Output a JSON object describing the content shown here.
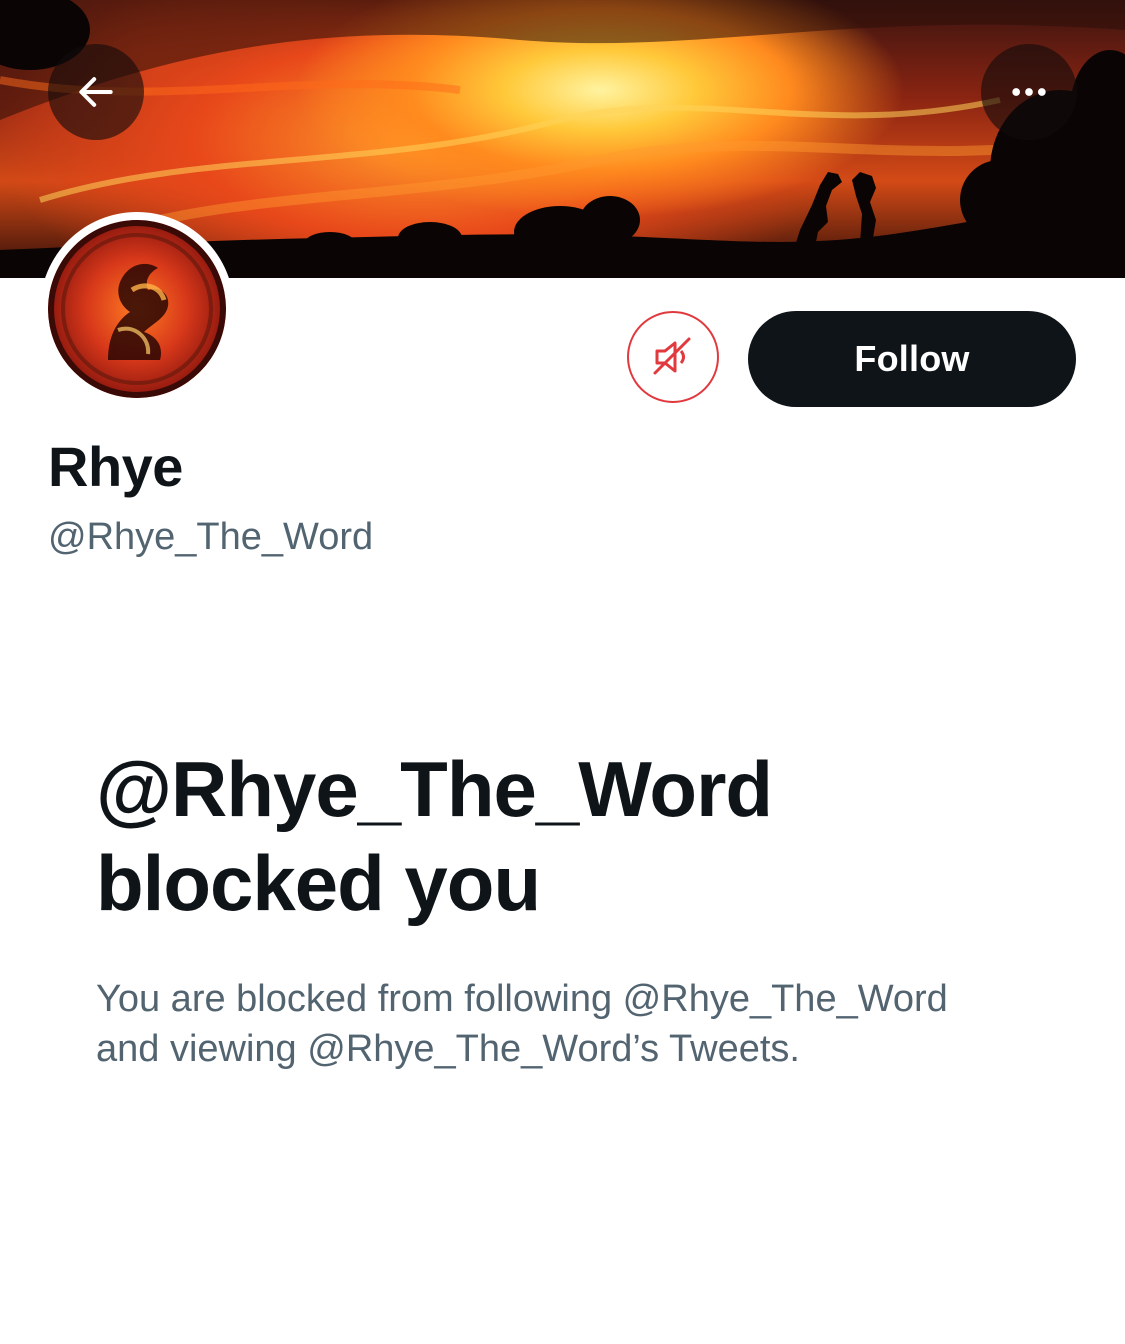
{
  "profile": {
    "display_name": "Rhye",
    "handle": "@Rhye_The_Word"
  },
  "actions": {
    "follow_label": "Follow"
  },
  "blocked": {
    "title_line1": "@Rhye_The_Word",
    "title_line2": "blocked you",
    "description_line1": "You are blocked from following @Rhye_The_Word",
    "description_line2": "and viewing @Rhye_The_Word’s Tweets."
  },
  "icons": {
    "back": "arrow-left-icon",
    "more": "more-horizontal-icon",
    "muted": "speaker-muted-icon"
  },
  "colors": {
    "follow_bg": "#0f1419",
    "muted_accent": "#e0393e",
    "secondary_text": "#536471",
    "primary_text": "#0f1419"
  }
}
